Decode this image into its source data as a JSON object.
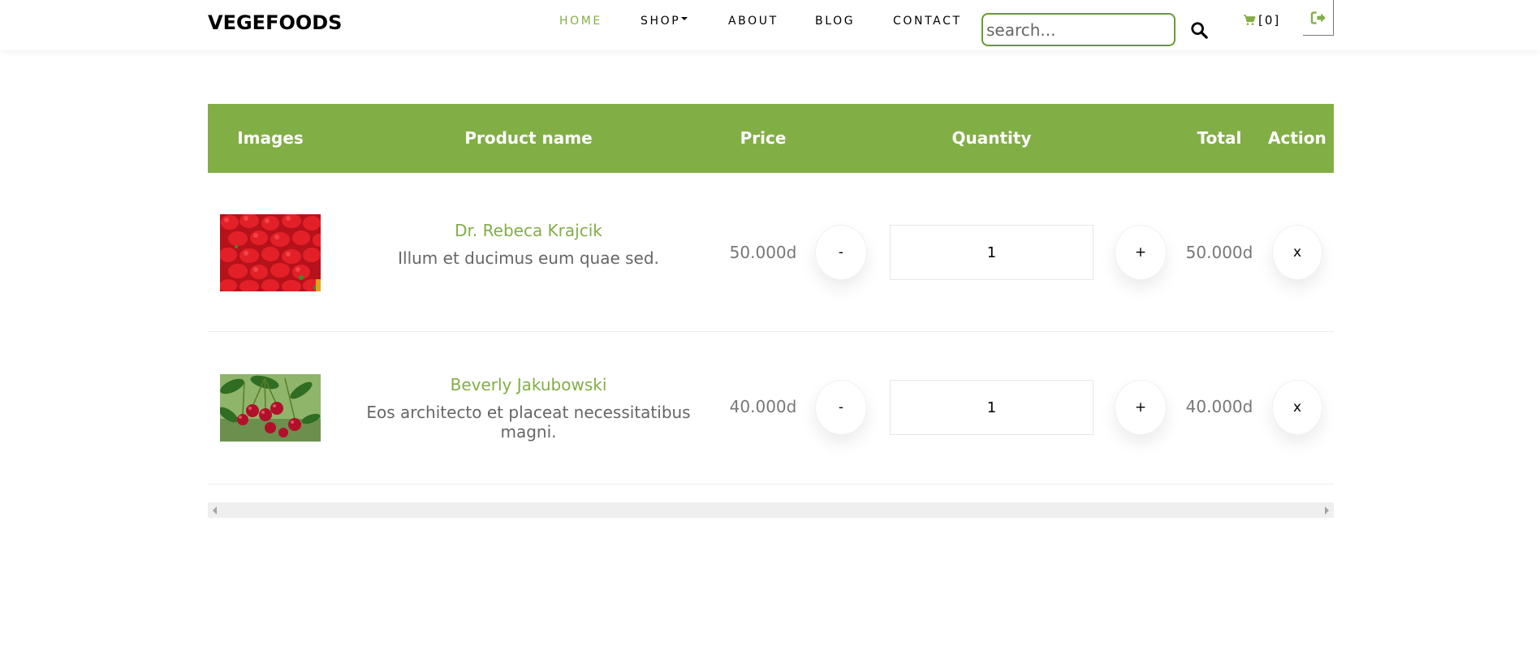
{
  "brand": {
    "name": "VEGEFOODS"
  },
  "nav": {
    "home": "HOME",
    "shop": "SHOP",
    "about": "ABOUT",
    "blog": "BLOG",
    "contact": "CONTACT"
  },
  "search": {
    "placeholder": "search...",
    "value": ""
  },
  "cart": {
    "count_label": "[0]"
  },
  "colors": {
    "accent": "#82ae46",
    "header_bg": "#82ae46",
    "text_muted": "#777777"
  },
  "icons": {
    "search": "search-icon",
    "cart": "cart-icon",
    "logout": "sign-out-icon"
  },
  "table": {
    "headers": [
      "Images",
      "Product name",
      "Price",
      "Quantity",
      "Total",
      "Action"
    ],
    "rows": [
      {
        "image_alt": "strawberries",
        "name": "Dr. Rebeca Krajcik",
        "description": "Illum et ducimus eum quae sed.",
        "price": "50.000d",
        "decrement_label": "-",
        "quantity": "1",
        "increment_label": "+",
        "total": "50.000d",
        "remove_label": "x"
      },
      {
        "image_alt": "cherries",
        "name": "Beverly Jakubowski",
        "description": "Eos architecto et placeat necessitatibus magni.",
        "price": "40.000d",
        "decrement_label": "-",
        "quantity": "1",
        "increment_label": "+",
        "total": "40.000d",
        "remove_label": "x"
      }
    ]
  }
}
